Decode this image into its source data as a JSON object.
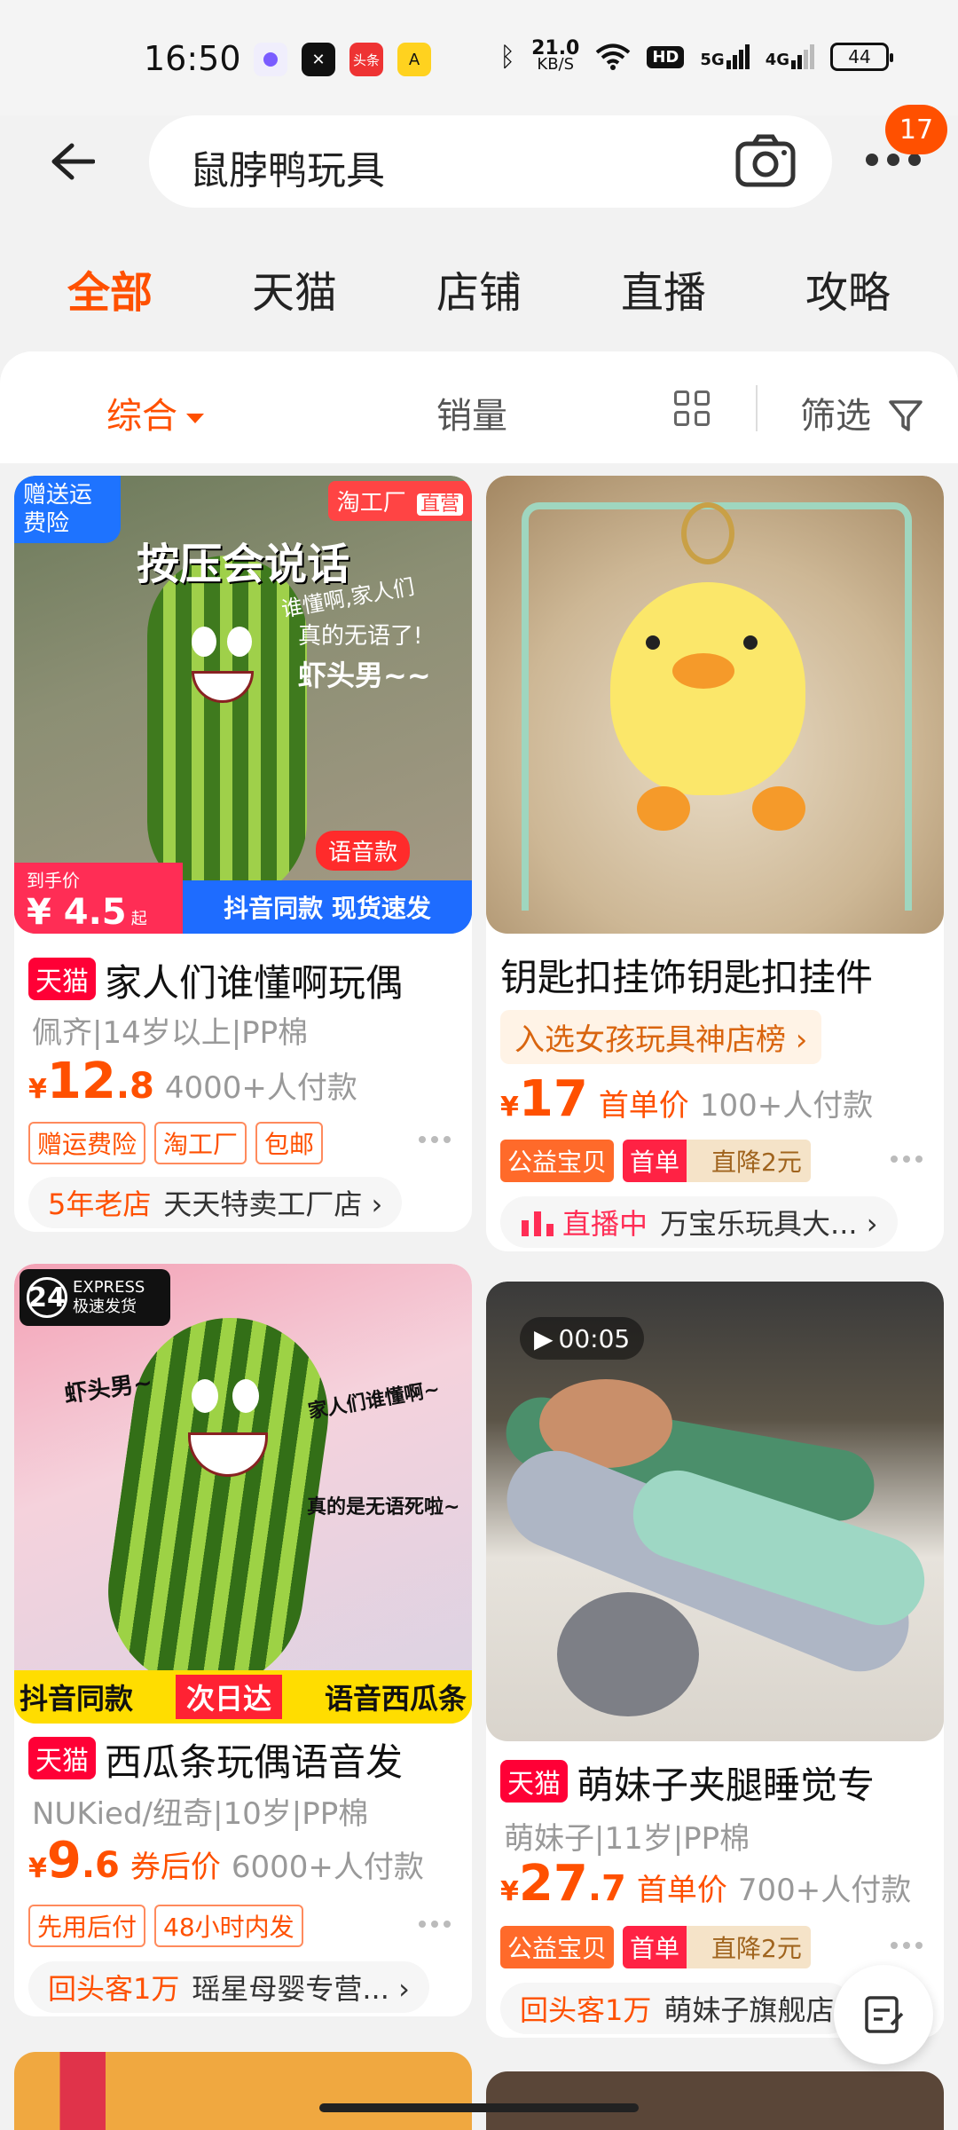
{
  "status_bar": {
    "time": "16:50",
    "net_speed_value": "21.0",
    "net_speed_unit": "KB/S",
    "hd_label": "HD",
    "signal_5g": "5G",
    "signal_4g": "4G",
    "battery": "44"
  },
  "search": {
    "query": "鼠脖鸭玩具",
    "notification_count": "17"
  },
  "tabs": [
    {
      "label": "全部"
    },
    {
      "label": "天猫"
    },
    {
      "label": "店铺"
    },
    {
      "label": "直播"
    },
    {
      "label": "攻略"
    }
  ],
  "sort": {
    "comprehensive": "综合",
    "sales": "销量",
    "filter": "筛选"
  },
  "products": [
    {
      "img_badge_top_left": "赠送运费险",
      "img_badge_top_right": "淘工厂",
      "img_badge_top_right_sub": "直营",
      "img_headline": "按压会说话",
      "img_caption_1": "谁懂啊,家人们",
      "img_caption_2": "真的无语了!",
      "img_caption_3": "虾头男~~",
      "img_voice": "语音款",
      "img_price_label": "到手价",
      "img_price_value": "¥ 4.5",
      "img_price_suffix": "起",
      "img_banner": "抖音同款 现货速发",
      "badge": "天猫",
      "title": "家人们谁懂啊玩偶",
      "spec": "佩齐|14岁以上|PP棉",
      "price_currency": "¥",
      "price_int": "12",
      "price_dec": ".8",
      "paid": "4000+人付款",
      "tags": [
        "赠运费险",
        "淘工厂",
        "包邮"
      ],
      "shop_highlight": "5年老店",
      "shop_name": "天天特卖工厂店 ›"
    },
    {
      "title": "钥匙扣挂饰钥匙扣挂件",
      "rank": "入选女孩玩具神店榜 ›",
      "price_currency": "¥",
      "price_int": "17",
      "price_dec": "",
      "price_tag": "首单价",
      "paid": "100+人付款",
      "tag_1": "公益宝贝",
      "tag_2": "首单",
      "tag_3": "直降2元",
      "shop_highlight": "直播中",
      "shop_name": "万宝乐玩具大... ›"
    },
    {
      "img_express_num": "24",
      "img_express_en": "EXPRESS",
      "img_express_cn": "极速发货",
      "img_caption_1": "虾头男~",
      "img_caption_2": "家人们谁懂啊~",
      "img_caption_3": "真的是无语死啦~",
      "img_banner_left": "抖音同款",
      "img_banner_mid": "次日达",
      "img_banner_right": "语音西瓜条",
      "badge": "天猫",
      "title": "西瓜条玩偶语音发",
      "spec": "NUKied/纽奇|10岁|PP棉",
      "price_currency": "¥",
      "price_int": "9",
      "price_dec": ".6",
      "price_tag": "券后价",
      "paid": "6000+人付款",
      "tags": [
        "先用后付",
        "48小时内发"
      ],
      "shop_highlight": "回头客1万",
      "shop_name": "瑶星母婴专营... ›"
    },
    {
      "video_time": "00:05",
      "badge": "天猫",
      "title": "萌妹子夹腿睡觉专",
      "spec": "萌妹子|11岁|PP棉",
      "price_currency": "¥",
      "price_int": "27",
      "price_dec": ".7",
      "price_tag": "首单价",
      "paid": "700+人付款",
      "tag_1": "公益宝贝",
      "tag_2": "首单",
      "tag_3": "直降2元",
      "shop_highlight": "回头客1万",
      "shop_name": "萌妹子旗舰店"
    }
  ]
}
